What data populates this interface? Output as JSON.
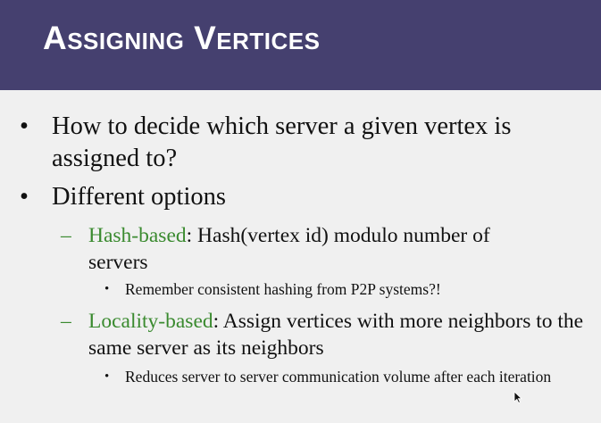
{
  "slide": {
    "title": "Assigning Vertices",
    "bullets": [
      {
        "marker": "•",
        "text": "How to decide which server a given vertex is assigned to?"
      },
      {
        "marker": "•",
        "text": "Different options",
        "children": [
          {
            "marker": "–",
            "term": "Hash-based",
            "text": ": Hash(vertex id) modulo number of servers",
            "children": [
              {
                "marker": "•",
                "text": "Remember consistent hashing from P2P systems?!"
              }
            ]
          },
          {
            "marker": "–",
            "term": "Locality-based",
            "text": ": Assign vertices with more neighbors to the same server as its neighbors",
            "children": [
              {
                "marker": "•",
                "text": "Reduces server to server communication volume after each iteration"
              }
            ]
          }
        ]
      }
    ]
  },
  "colors": {
    "title_bar": "#45406f",
    "title_text": "#ffffff",
    "background": "#f0f0f0",
    "body_text": "#111111",
    "accent_green": "#3a8a2f"
  },
  "icons": {
    "cursor": "mouse-pointer-icon"
  }
}
